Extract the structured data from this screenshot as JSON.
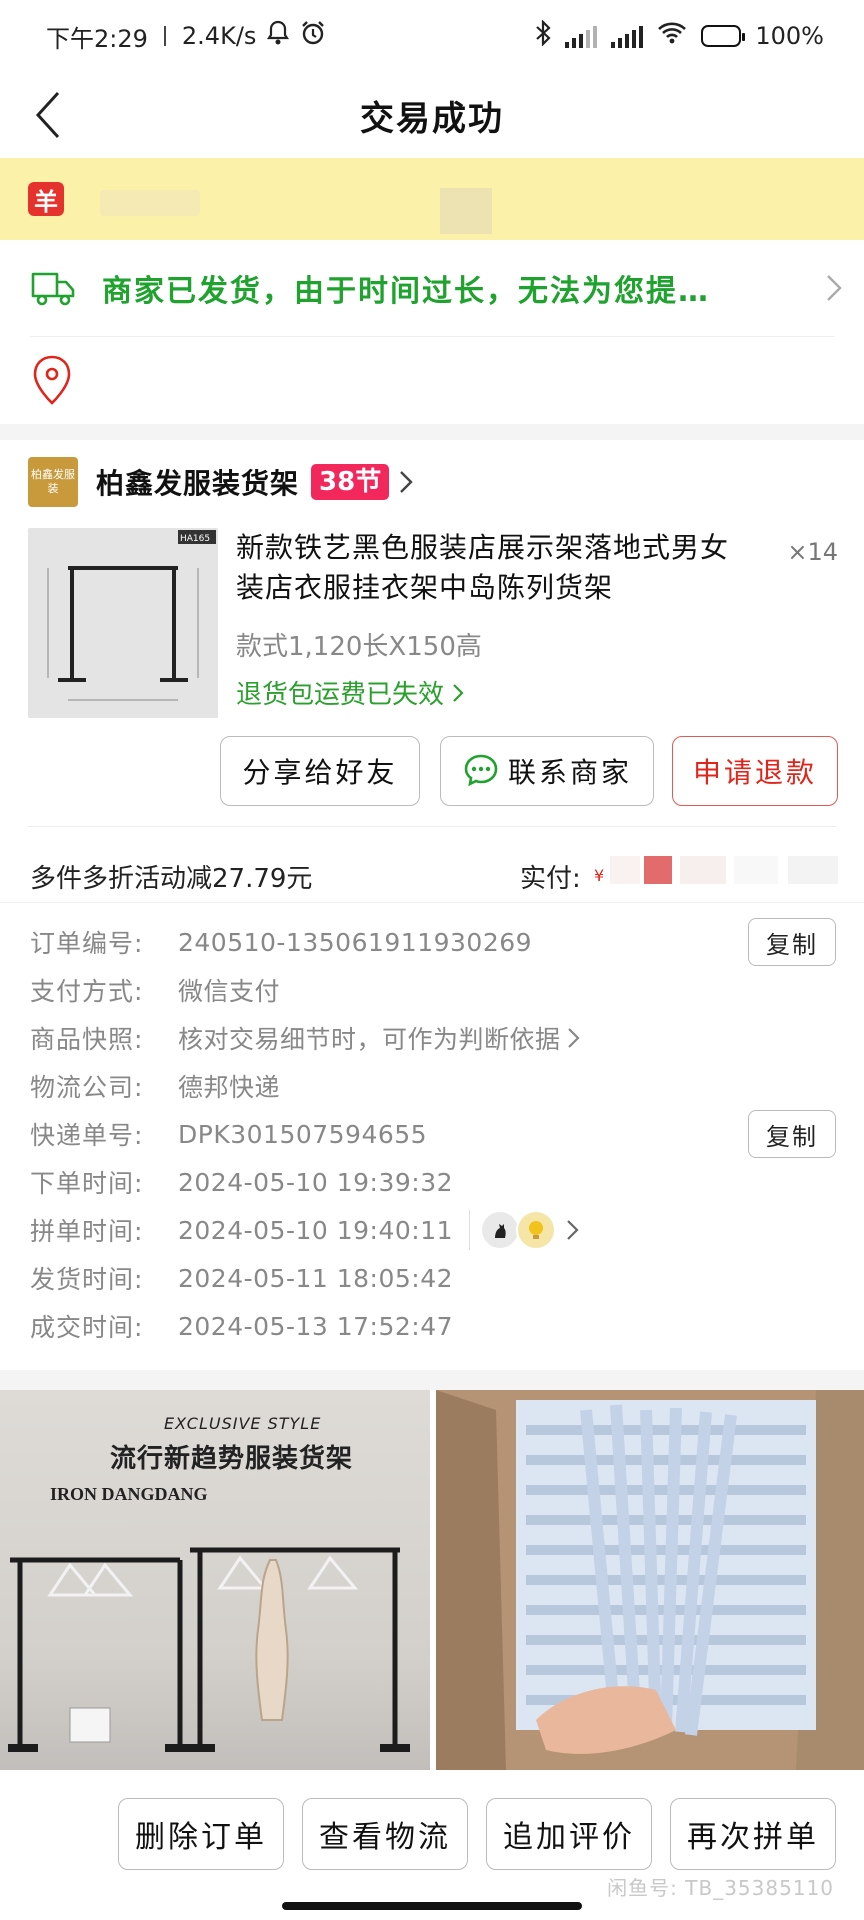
{
  "status_bar": {
    "time": "下午2:29",
    "speed": "2.4K/s",
    "battery": "100%",
    "icons": [
      "bell-icon",
      "alarm-icon",
      "bluetooth-icon",
      "signal-icon",
      "signal-icon",
      "wifi-icon",
      "battery-icon"
    ]
  },
  "nav": {
    "title": "交易成功"
  },
  "banner": {
    "badge": "羊"
  },
  "logistics": {
    "message": "商家已发货，由于时间过长，无法为您提…"
  },
  "shop": {
    "logo_text": "柏鑫发服装",
    "name": "柏鑫发服装货架",
    "tag": "38节"
  },
  "product": {
    "title": "新款铁艺黑色服装店展示架落地式男女装店衣服挂衣架中岛陈列货架",
    "quantity": "×14",
    "spec": "款式1,120长X150高",
    "return_note": "退货包运费已失效",
    "image_label": "HA165"
  },
  "actions": {
    "share": "分享给好友",
    "contact": "联系商家",
    "refund": "申请退款"
  },
  "summary": {
    "discount": "多件多折活动减27.79元",
    "paid_label": "实付:",
    "currency": "¥"
  },
  "order_info": [
    {
      "label": "订单编号:",
      "value": "240510-135061911930269",
      "copy": "复制"
    },
    {
      "label": "支付方式:",
      "value": "微信支付"
    },
    {
      "label": "商品快照:",
      "value": "核对交易细节时，可作为判断依据"
    },
    {
      "label": "物流公司:",
      "value": "德邦快递"
    },
    {
      "label": "快递单号:",
      "value": "DPK301507594655",
      "copy": "复制"
    },
    {
      "label": "下单时间:",
      "value": "2024-05-10 19:39:32"
    },
    {
      "label": "拼单时间:",
      "value": "2024-05-10 19:40:11"
    },
    {
      "label": "发货时间:",
      "value": "2024-05-11 18:05:42"
    },
    {
      "label": "成交时间:",
      "value": "2024-05-13 17:52:47"
    }
  ],
  "recommendations": {
    "left": {
      "style_text": "EXCLUSIVE STYLE",
      "title": "流行新趋势服装货架",
      "brand": "IRON DANGDANG"
    }
  },
  "bottom_bar": {
    "delete": "删除订单",
    "logistics": "查看物流",
    "review": "追加评价",
    "reorder": "再次拼单",
    "watermark": "闲鱼号: TB_35385110"
  },
  "colors": {
    "green": "#1fa22e",
    "red": "#e1251b",
    "banner_yellow": "#fbf1a8",
    "tag_pink": "#f2275b"
  }
}
